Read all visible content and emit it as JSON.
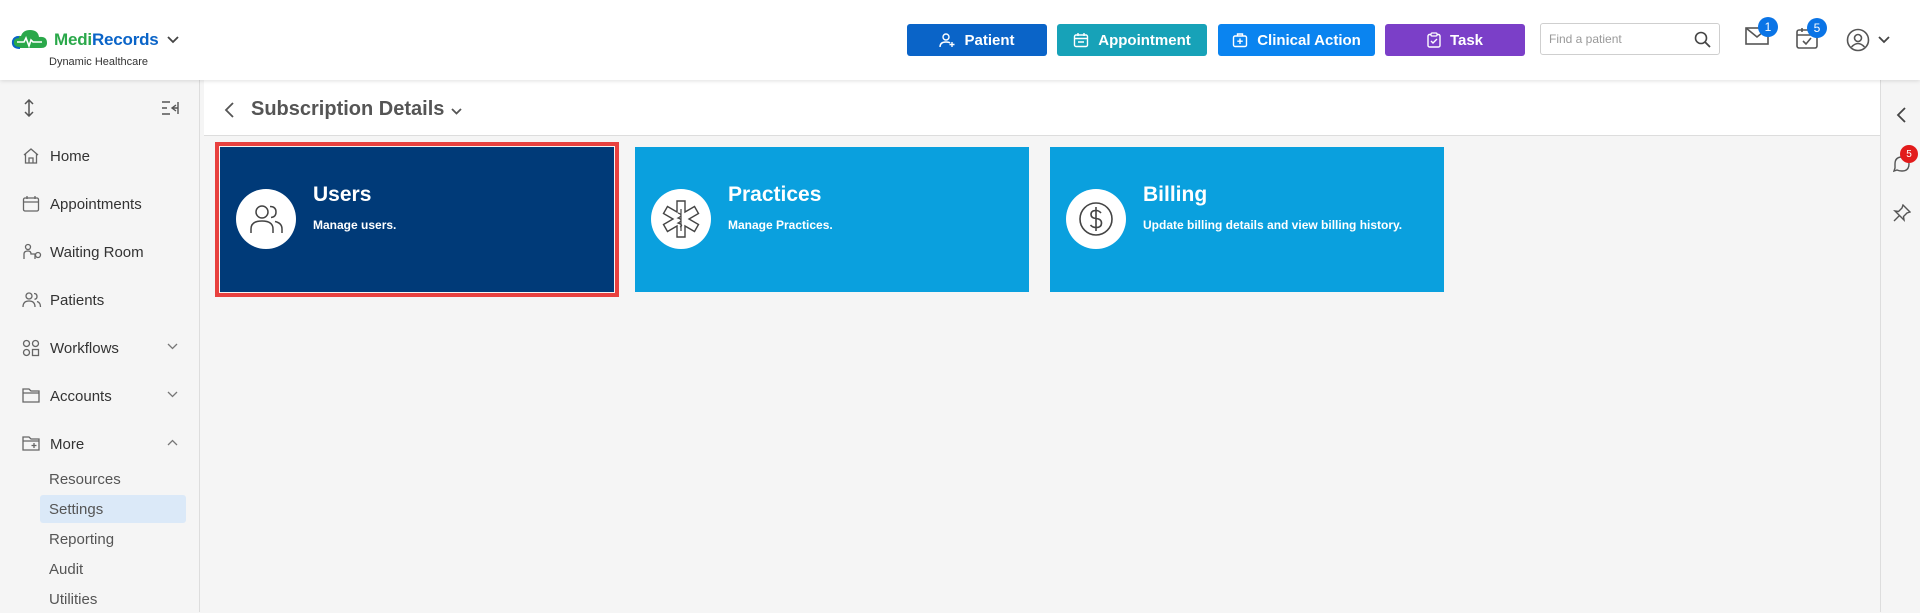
{
  "brand": {
    "name_part1": "Medi",
    "name_part2": "Records",
    "subtitle": "Dynamic Healthcare",
    "logo_icon": "cloud-heartbeat-icon"
  },
  "toolbar": {
    "buttons": [
      {
        "label": "Patient",
        "icon": "add-person-icon",
        "color": "#0a64c8"
      },
      {
        "label": "Appointment",
        "icon": "calendar-icon",
        "color": "#17a2b8"
      },
      {
        "label": "Clinical Action",
        "icon": "medical-kit-icon",
        "color": "#0a84f0"
      },
      {
        "label": "Task",
        "icon": "clipboard-icon",
        "color": "#7b3fc8"
      }
    ],
    "search": {
      "placeholder": "Find a patient",
      "value": ""
    },
    "messages_badge": "1",
    "tasks_badge": "5"
  },
  "sidebar": {
    "items": [
      {
        "label": "Home",
        "icon": "home-icon"
      },
      {
        "label": "Appointments",
        "icon": "calendar-icon"
      },
      {
        "label": "Waiting Room",
        "icon": "waiting-room-icon"
      },
      {
        "label": "Patients",
        "icon": "patients-icon"
      },
      {
        "label": "Workflows",
        "icon": "workflows-icon",
        "expandable": true
      },
      {
        "label": "Accounts",
        "icon": "folder-icon",
        "expandable": true
      },
      {
        "label": "More",
        "icon": "folder-plus-icon",
        "expandable": true,
        "expanded": true
      }
    ],
    "more_items": [
      {
        "label": "Resources"
      },
      {
        "label": "Settings",
        "active": true
      },
      {
        "label": "Reporting"
      },
      {
        "label": "Audit"
      },
      {
        "label": "Utilities"
      }
    ]
  },
  "page": {
    "title": "Subscription Details"
  },
  "cards": [
    {
      "title": "Users",
      "description": "Manage users.",
      "icon": "users-icon",
      "selected": true
    },
    {
      "title": "Practices",
      "description": "Manage Practices.",
      "icon": "star-of-life-icon",
      "selected": false
    },
    {
      "title": "Billing",
      "description": "Update billing details and view billing history.",
      "icon": "dollar-icon",
      "selected": false
    }
  ],
  "right_rail": {
    "chat_badge": "5"
  },
  "colors": {
    "card_blue": "#0aa0de",
    "card_selected": "#003a78",
    "selection_outline": "#e8413f",
    "accent": "#0a64c8"
  }
}
